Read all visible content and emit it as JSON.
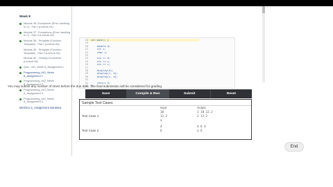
{
  "sidebar": {
    "week_title": "Week 8",
    "items": [
      {
        "label": "Module 36: Exceptions (Error handling in C) : Part I (Lecture 61)",
        "bullet": true,
        "link": false
      },
      {
        "label": "Module 37 : Exceptions (Error handling in C) : Part II (Lecture 62)",
        "bullet": true,
        "link": false
      },
      {
        "label": "Module 38 : Template (Function Template) : Part I (Lecture 63)",
        "bullet": true,
        "link": false
      },
      {
        "label": "Module 39 : Template (Function Template) : Part II (Lecture 64)",
        "bullet": false,
        "link": false
      },
      {
        "label": "Module 40 : Closing Comments (Lecture 65)",
        "bullet": false,
        "link": false
      },
      {
        "label": "Quiz : NO_Week 8_Assignment 1",
        "bullet": true,
        "link": false
      },
      {
        "label": "Programming_MO_Week 8_Assignment 1",
        "bullet": true,
        "link": true
      },
      {
        "label": "Programming_MO_Week 8_Assignment 2",
        "bullet": true,
        "link": false
      },
      {
        "label": "Programming_MO_Week 8_Assignment 3",
        "bullet": true,
        "link": false
      },
      {
        "label": "Programming_MO_Week 8_Assignment 4",
        "bullet": true,
        "link": false
      }
    ],
    "footer": "MOOCs 3_Assignment solutions"
  },
  "code": {
    "lines": [
      {
        "n": "18",
        "t": "int main() {"
      },
      {
        "n": "19",
        "t": ""
      },
      {
        "n": "20",
        "t": "    double d;"
      },
      {
        "n": "21",
        "t": "    int i;"
      },
      {
        "n": "22",
        "t": "    char c;"
      },
      {
        "n": "23",
        "t": ""
      },
      {
        "n": "24",
        "t": "    cin >> d;"
      },
      {
        "n": "25",
        "t": "    cin >> i;"
      },
      {
        "n": "26",
        "t": "    cin >> c;"
      },
      {
        "n": "27",
        "t": ""
      },
      {
        "n": "28",
        "t": "    display(d);"
      },
      {
        "n": "29",
        "t": "    display(i, d);"
      },
      {
        "n": "30",
        "t": "    display(c, d);"
      },
      {
        "n": "31",
        "t": ""
      },
      {
        "n": "32",
        "t": "    return 0;"
      },
      {
        "n": "33",
        "t": "}"
      }
    ]
  },
  "note": "You may submit any number of times before the due date. The final submission will be considered for grading.",
  "actions": {
    "save": "Save",
    "compile_run": "Compile & Run",
    "submit": "Submit",
    "reset": "Reset"
  },
  "test_cases": {
    "header": "Sample Test Cases",
    "input_label": "Input",
    "output_label": "Output",
    "cases": [
      {
        "label": "Test Case 1",
        "inputs": [
          "10",
          "12.2",
          "a"
        ],
        "outputs": [
          "1 10 12.2",
          "2 12.2"
        ]
      },
      {
        "label": "Test Case 2",
        "inputs": [
          "4",
          "6"
        ],
        "outputs": [
          "4 6 4",
          "a 6"
        ]
      }
    ]
  },
  "end_button": "End",
  "colors": {
    "button_bar": "#2f3136",
    "accent_link": "#2b4f88",
    "bullet": "#3a7a3a"
  }
}
